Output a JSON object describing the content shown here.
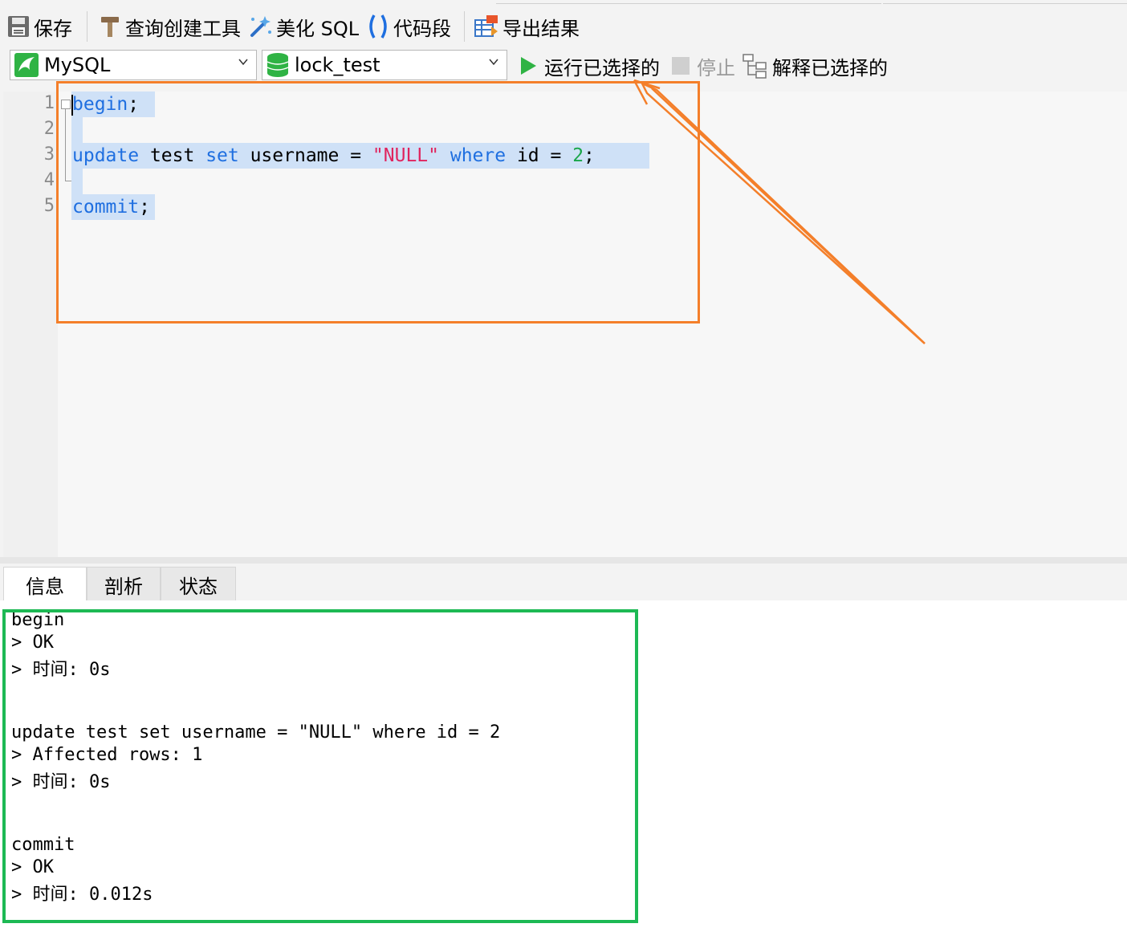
{
  "toolbar": {
    "save_label": "保存",
    "query_builder_label": "查询创建工具",
    "beautify_label": "美化 SQL",
    "snippet_label": "代码段",
    "export_label": "导出结果",
    "run_selected_label": "运行已选择的",
    "stop_label": "停止",
    "explain_selected_label": "解释已选择的"
  },
  "connection": {
    "selected": "MySQL"
  },
  "database": {
    "selected": "lock_test"
  },
  "editor": {
    "line_numbers": [
      "1",
      "2",
      "3",
      "4",
      "5"
    ],
    "tokens": {
      "begin": "begin",
      "semi": ";",
      "update": "update",
      "test": " test ",
      "set": "set",
      "username": " username = ",
      "null_str": "\"NULL\"",
      "where": " where",
      "id": " id = ",
      "two": "2",
      "commit": "commit"
    }
  },
  "result_tabs": [
    {
      "label": "信息",
      "active": true
    },
    {
      "label": "剖析",
      "active": false
    },
    {
      "label": "状态",
      "active": false
    }
  ],
  "output": {
    "lines": [
      "begin",
      "> OK",
      "> 时间: 0s",
      "update test set username = \"NULL\" where id = 2",
      "> Affected rows: 1",
      "> 时间: 0s",
      "commit",
      "> OK",
      "> 时间: 0.012s"
    ]
  },
  "colors": {
    "annotation_orange": "#f47f2a",
    "annotation_green": "#1db954",
    "keyword": "#1f6fe0",
    "string": "#e0245e",
    "number": "#1aa64a",
    "selection": "#cfe1f7"
  }
}
